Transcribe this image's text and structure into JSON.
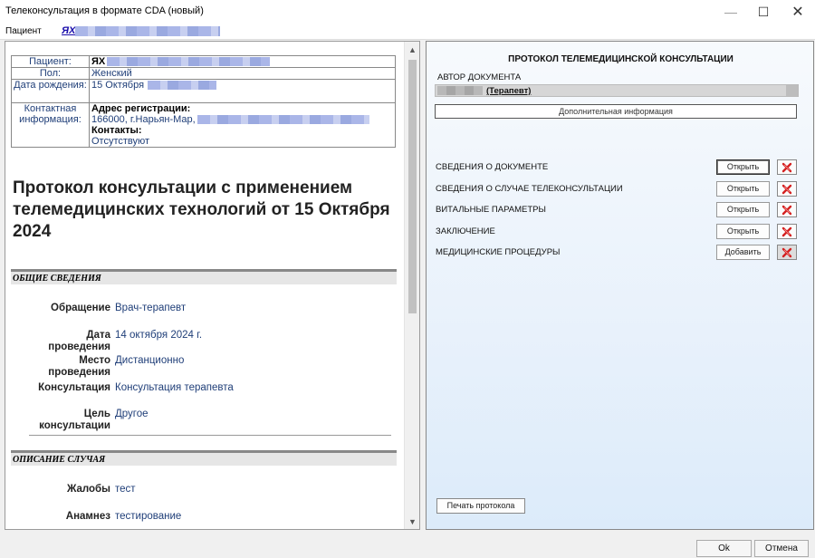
{
  "window": {
    "title": "Телеконсультация в формате CDA (новый)",
    "minimize": "—",
    "maximize": "☐",
    "close": "✕"
  },
  "patient_bar": {
    "label": "Пациент",
    "link_prefix": "ЯХ"
  },
  "document": {
    "patient_table": {
      "patient_label": "Пациент:",
      "patient_value": "ЯХ",
      "sex_label": "Пол:",
      "sex_value": "Женский",
      "dob_label": "Дата рождения:",
      "dob_value": "15 Октября",
      "contact_label": "Контактная информация:",
      "reg_address_label": "Адрес регистрации:",
      "reg_address_value": "166000, г.Нарьян-Мар,",
      "contacts_label": "Контакты:",
      "contacts_value": "Отсутствуют"
    },
    "title": "Протокол консультации с применением телемедицинских технологий от 15 Октября 2024",
    "section_general": "ОБЩИЕ СВЕДЕНИЯ",
    "general": [
      {
        "key": "Обращение",
        "value": "Врач-терапевт"
      },
      {
        "key": "Дата проведения",
        "value": "14 октября 2024 г."
      },
      {
        "key": "Место проведения",
        "value": "Дистанционно"
      },
      {
        "key": "Консультация",
        "value": "Консультация терапевта"
      },
      {
        "key": "Цель консультации",
        "value": "Другое"
      }
    ],
    "section_case": "ОПИСАНИЕ СЛУЧАЯ",
    "case": [
      {
        "key": "Жалобы",
        "value": "тест"
      },
      {
        "key": "Анамнез",
        "value": "тестирование"
      }
    ]
  },
  "panel": {
    "title": "ПРОТОКОЛ ТЕЛЕМЕДИЦИНСКОЙ КОНСУЛЬТАЦИИ",
    "author_label": "АВТОР ДОКУМЕНТА",
    "author_name": "(Терапевт)",
    "additional_info": "Дополнительная информация",
    "sections": [
      {
        "label": "СВЕДЕНИЯ О ДОКУМЕНТЕ",
        "button": "Открыть"
      },
      {
        "label": "СВЕДЕНИЯ О СЛУЧАЕ ТЕЛЕКОНСУЛЬТАЦИИ",
        "button": "Открыть"
      },
      {
        "label": "ВИТАЛЬНЫЕ ПАРАМЕТРЫ",
        "button": "Открыть"
      },
      {
        "label": "ЗАКЛЮЧЕНИЕ",
        "button": "Открыть"
      },
      {
        "label": "МЕДИЦИНСКИЕ ПРОЦЕДУРЫ",
        "button": "Добавить"
      }
    ],
    "print_button": "Печать протокола"
  },
  "footer": {
    "ok": "Ok",
    "cancel": "Отмена"
  }
}
